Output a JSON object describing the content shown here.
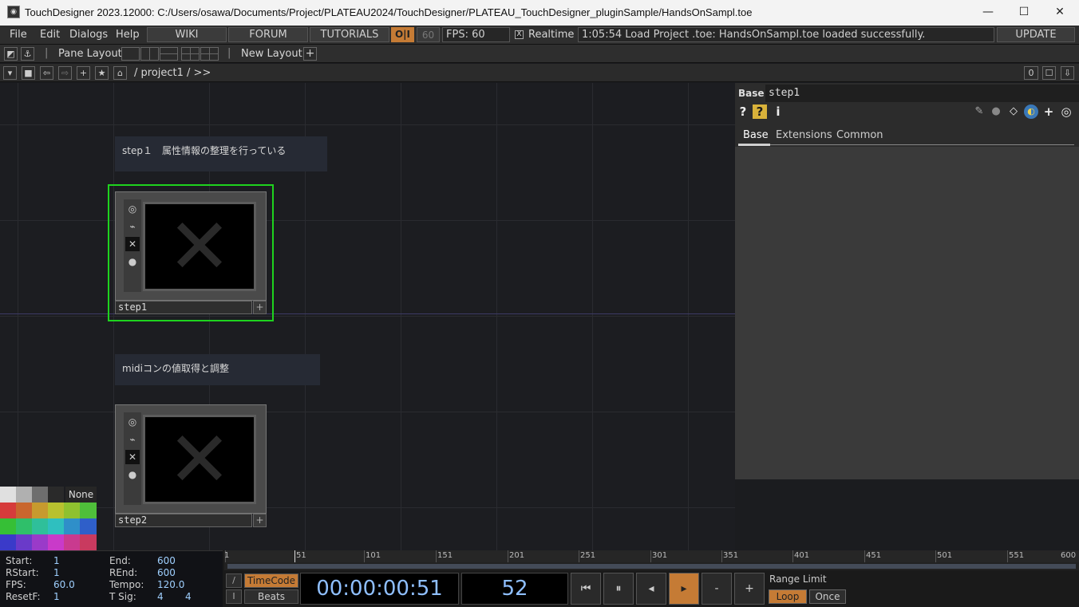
{
  "window": {
    "title": "TouchDesigner 2023.12000: C:/Users/osawa/Documents/Project/PLATEAU2024/TouchDesigner/PLATEAU_TouchDesigner_pluginSample/HandsOnSampl.toe",
    "minimize": "—",
    "maximize": "☐",
    "close": "✕"
  },
  "menubar": {
    "menus": [
      "File",
      "Edit",
      "Dialogs",
      "Help"
    ],
    "wiki": "WIKI",
    "forum": "FORUM",
    "tutorials": "TUTORIALS",
    "oi": "O|I",
    "fps_target": "60",
    "fps": "FPS:  60",
    "realtime_label": "Realtime",
    "realtime_checked": "X",
    "status": "1:05:54 Load Project .toe: HandsOnSampl.toe loaded successfully.",
    "update": "UPDATE"
  },
  "panebar": {
    "pane_layout": "Pane Layout",
    "new_layout": "New Layout",
    "separator": "|",
    "plus": "+"
  },
  "navbar": {
    "path": "/ project1 / >>",
    "count": "0"
  },
  "network": {
    "comments": [
      "step１　属性情報の整理を行っている",
      "midiコンの値取得と調整"
    ],
    "nodes": [
      {
        "name": "step1",
        "selected": true
      },
      {
        "name": "step2",
        "selected": false
      }
    ]
  },
  "params": {
    "op_type": "Base",
    "op_name": "step1",
    "tabs": [
      "Base",
      "Extensions",
      "Common"
    ],
    "active_tab": "Base"
  },
  "palette": {
    "none_label": "None",
    "colors": [
      "#e0e0e0",
      "#b0b0b0",
      "#6e6e6e",
      "#2a2a2a",
      "#d63b3b",
      "#c9662e",
      "#c79a2e",
      "#b8c12f",
      "#8fc12f",
      "#4fbf3a",
      "#36bf36",
      "#2fbf6a",
      "#2fbf9a",
      "#2fbfbf",
      "#2f8fc9",
      "#2f5fc9",
      "#3a3ac9",
      "#6a3ac9",
      "#9a3ac9",
      "#c93ac9",
      "#c93a8f",
      "#c93a5f"
    ]
  },
  "timeline": {
    "start_label": "Start:",
    "start": "1",
    "rstart_label": "RStart:",
    "rstart": "1",
    "fps_label": "FPS:",
    "fps": "60.0",
    "resetf_label": "ResetF:",
    "resetf": "1",
    "end_label": "End:",
    "end": "600",
    "rend_label": "REnd:",
    "rend": "600",
    "tempo_label": "Tempo:",
    "tempo": "120.0",
    "tsig_label": "T Sig:",
    "tsig_num": "4",
    "tsig_den": "4",
    "ruler_labels": [
      "1",
      "51",
      "101",
      "151",
      "201",
      "251",
      "301",
      "351",
      "401",
      "451",
      "501",
      "551",
      "600"
    ],
    "timecode_btn": "TimeCode",
    "beats_btn": "Beats",
    "timecode": "00:00:00:51",
    "frame": "52",
    "range_limit": "Range Limit",
    "loop": "Loop",
    "once": "Once",
    "minus": "-",
    "plus": "+",
    "slash": "/",
    "i_btn": "I"
  }
}
